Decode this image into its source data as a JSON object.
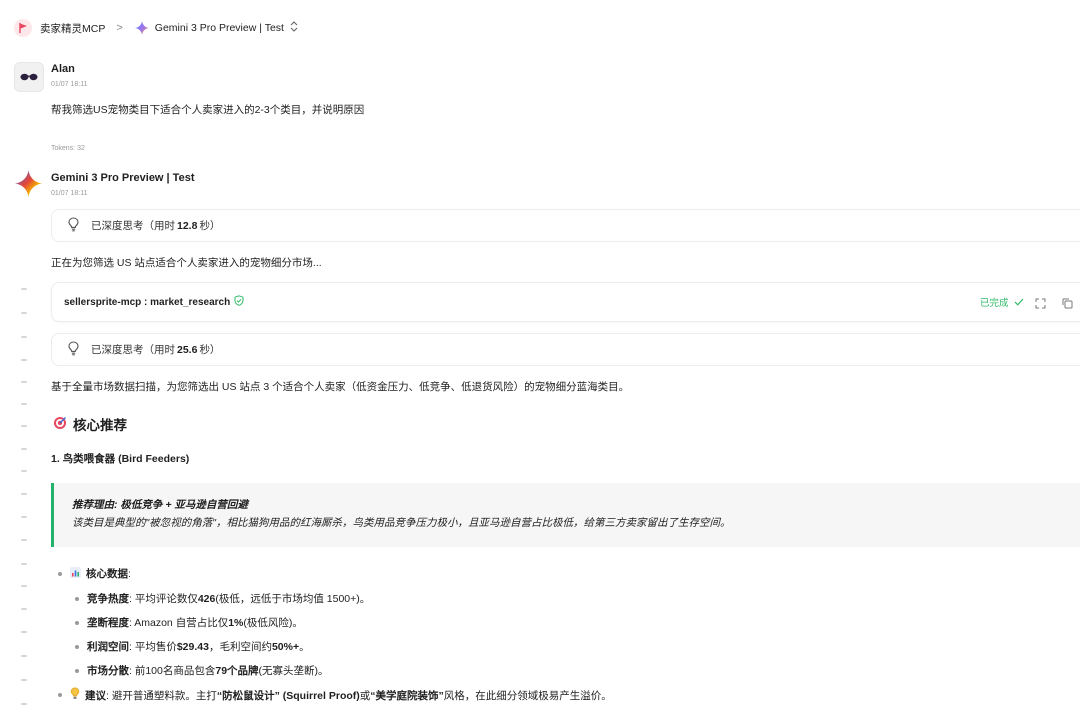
{
  "breadcrumb": {
    "workspace": "卖家精灵MCP",
    "separator": ">",
    "model": "Gemini 3 Pro Preview | Test",
    "switch_icon": "updown-chevron-icon"
  },
  "user_message": {
    "name": "Alan",
    "time": "01/07 18:11",
    "text": "帮我筛选US宠物类目下适合个人卖家进入的2-3个类目，并说明原因",
    "tokens": "Tokens: 32"
  },
  "assistant": {
    "name": "Gemini 3 Pro Preview | Test",
    "time": "01/07 18:11",
    "think1": {
      "prefix": "已深度思考（用时",
      "value": "12.8",
      "suffix": "秒）"
    },
    "intro": "正在为您筛选 US 站点适合个人卖家进入的宠物细分市场...",
    "tool": {
      "name": "sellersprite-mcp : market_research",
      "status": "已完成"
    },
    "think2": {
      "prefix": "已深度思考（用时",
      "value": "25.6",
      "suffix": "秒）"
    },
    "summary": "基于全量市场数据扫描，为您筛选出 US 站点 3 个适合个人卖家（低资金压力、低竞争、低退货风险）的宠物细分蓝海类目。",
    "section_title": "核心推荐",
    "item1_title": "1. 鸟类喂食器 (Bird Feeders)",
    "quote_title": "推荐理由: 极低竞争 + 亚马逊自营回避",
    "quote_body": "该类目是典型的\"被忽视的角落\"，相比猫狗用品的红海厮杀，鸟类用品竞争压力极小，且亚马逊自营占比极低，给第三方卖家留出了生存空间。",
    "core_data_label": "核心数据",
    "core_data_colon": ":",
    "metrics": [
      {
        "label": "竞争热度",
        "pre": ": 平均评论数仅 ",
        "bold": "426",
        "post": " (极低，远低于市场均值 1500+)。"
      },
      {
        "label": "垄断程度",
        "pre": ": Amazon 自营占比仅 ",
        "bold": "1%",
        "post": " (极低风险)。"
      },
      {
        "label": "利润空间",
        "pre": ": 平均售价 ",
        "bold": "$29.43",
        "post": "，毛利空间约 ",
        "bold2": "50%+",
        "post2": "。"
      },
      {
        "label": "市场分散",
        "pre": ": 前100名商品包含 ",
        "bold": "79个品牌",
        "post": " (无寡头垄断)。"
      }
    ],
    "advice": {
      "label": "建议",
      "pre": ": 避开普通塑料款。主打 ",
      "b1": "“防松鼠设计” (Squirrel Proof)",
      "mid": " 或 ",
      "b2": "“美学庭院装饰”",
      "post": " 风格，在此细分领域极易产生溢价。"
    }
  },
  "colors": {
    "accent_green": "#22b26a",
    "status_green": "#32b86a"
  }
}
